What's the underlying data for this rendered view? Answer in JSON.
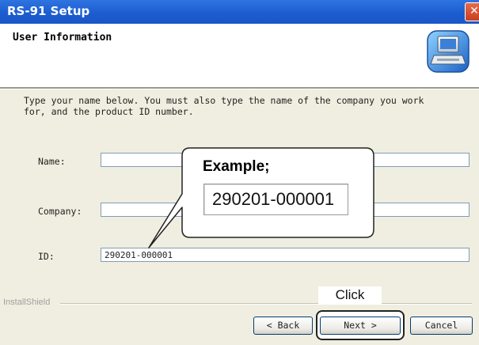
{
  "window": {
    "title": "RS-91 Setup",
    "close_glyph": "✕"
  },
  "header": {
    "title": "User Information",
    "icon": "setup-computer-icon"
  },
  "description": "Type your name below. You must also type the name of the company you work\nfor, and the product ID number.",
  "form": {
    "name_label": "Name:",
    "name_value": "",
    "company_label": "Company:",
    "company_value": "",
    "id_label": "ID:",
    "id_value": "290201-000001"
  },
  "footer": {
    "brand": "InstallShield"
  },
  "buttons": {
    "back": "< Back",
    "next": "Next >",
    "cancel": "Cancel"
  },
  "annotations": {
    "example_title": "Example;",
    "example_value": "290201-000001",
    "click_label": "Click"
  }
}
